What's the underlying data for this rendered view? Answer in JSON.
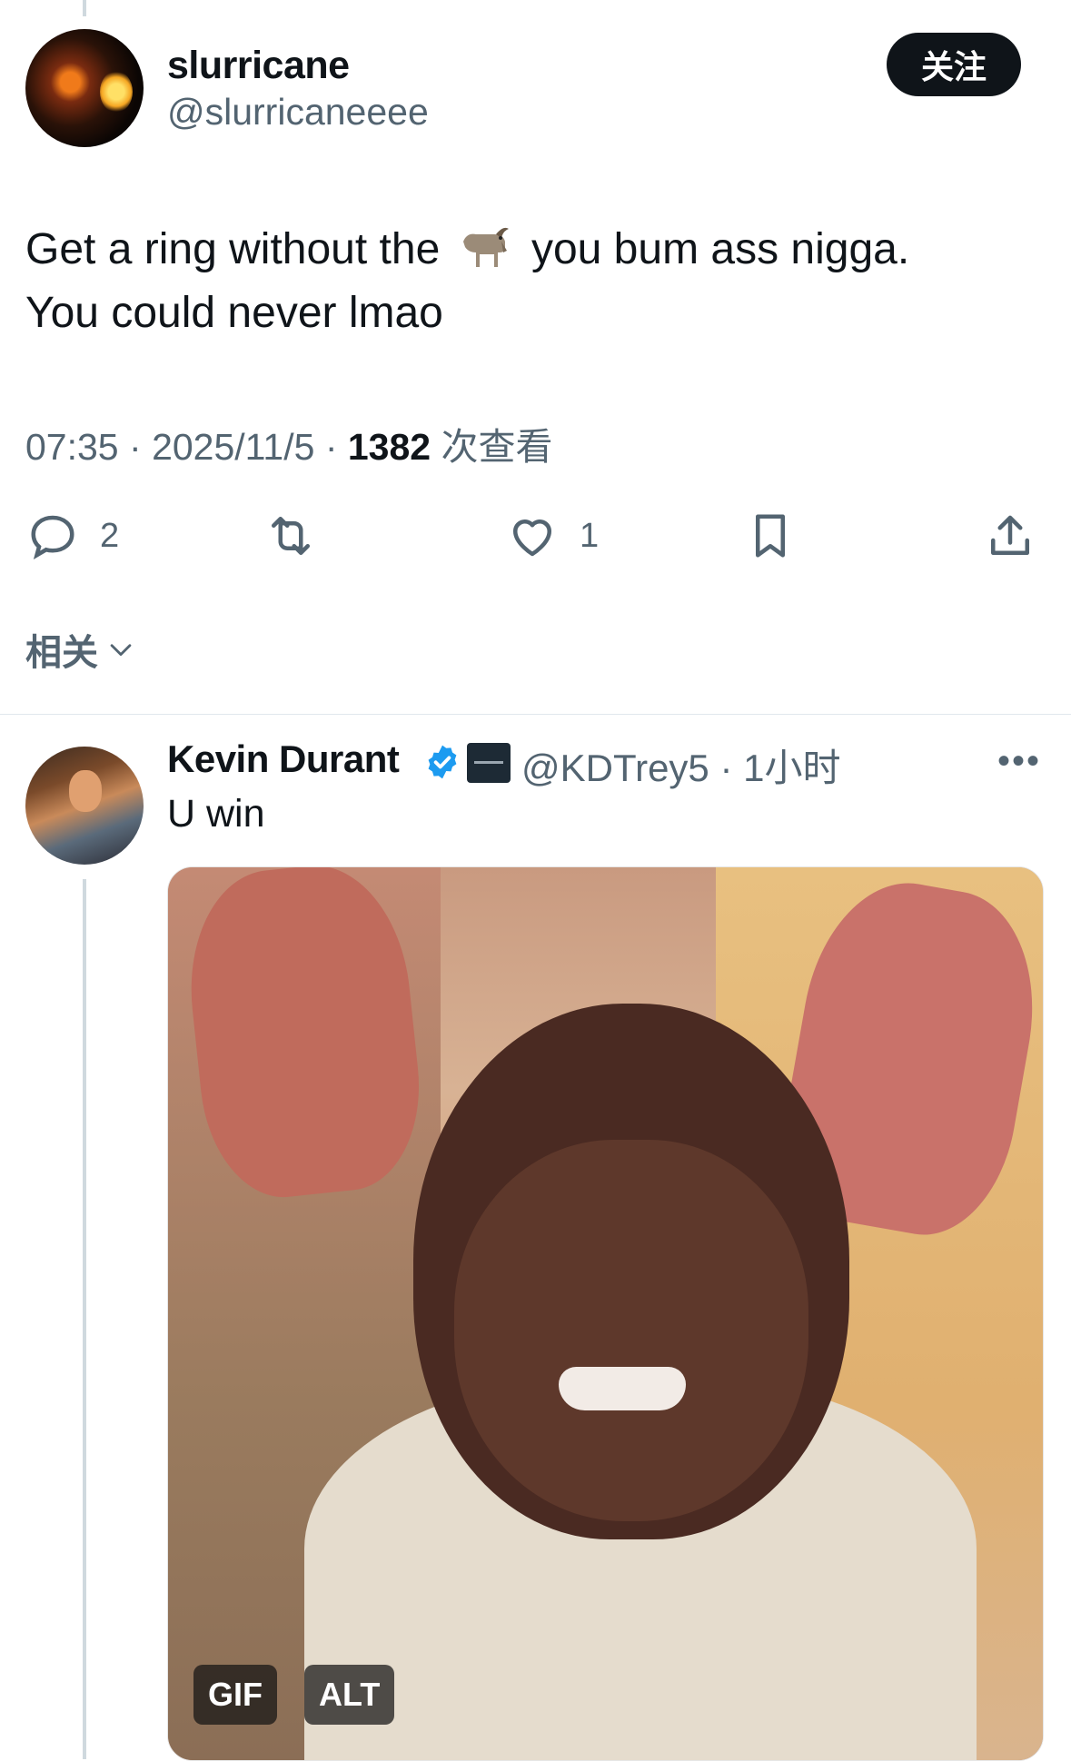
{
  "tweet": {
    "author": {
      "display_name": "slurricane",
      "handle": "@slurricaneeee"
    },
    "follow_label": "关注",
    "text_line1_before": "Get a ring without the",
    "emoji": "goat-icon",
    "text_line1_after": "you bum ass nigga.",
    "text_line2": "You could never lmao",
    "meta": {
      "time": "07:35",
      "date": "2025/11/5",
      "views_count": "1382",
      "views_label": "次查看"
    },
    "actions": {
      "replies": "2",
      "retweets": "",
      "likes": "1"
    },
    "related_label": "相关"
  },
  "reply": {
    "author": {
      "display_name": "Kevin Durant",
      "handle": "@KDTrey5",
      "time": "1小时"
    },
    "text": "U win",
    "media": {
      "gif_label": "GIF",
      "alt_label": "ALT"
    }
  },
  "colors": {
    "text": "#0f1419",
    "secondary": "#536471",
    "verified": "#1d9bf0",
    "divider": "#e1e8ed"
  }
}
